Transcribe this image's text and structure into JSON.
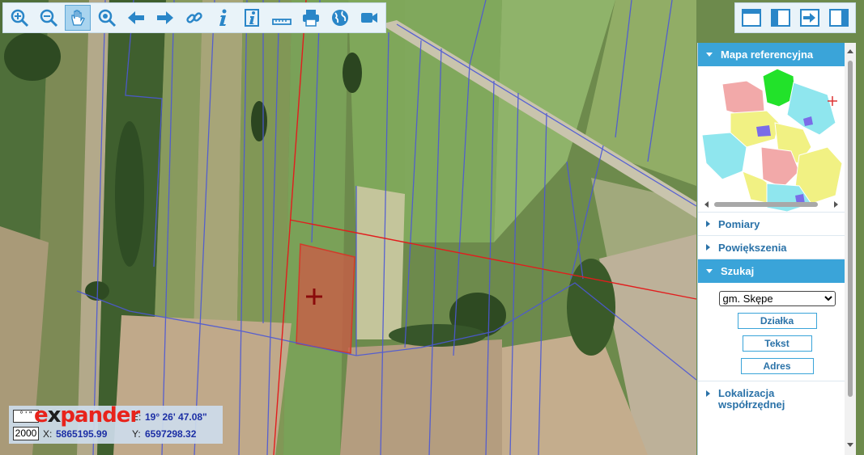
{
  "toolbar": {
    "items": [
      {
        "name": "zoom-in-button",
        "icon": "zoom-in-icon"
      },
      {
        "name": "zoom-out-button",
        "icon": "zoom-out-icon"
      },
      {
        "name": "pan-button",
        "icon": "hand-icon",
        "active": true
      },
      {
        "name": "zoom-extent-button",
        "icon": "magnifier-icon"
      },
      {
        "name": "back-button",
        "icon": "arrow-left-icon"
      },
      {
        "name": "forward-button",
        "icon": "arrow-right-icon"
      },
      {
        "name": "link-button",
        "icon": "link-icon"
      },
      {
        "name": "info-button",
        "icon": "info-icon"
      },
      {
        "name": "info-detail-button",
        "icon": "info-document-icon"
      },
      {
        "name": "measure-button",
        "icon": "ruler-icon"
      },
      {
        "name": "print-button",
        "icon": "printer-icon"
      },
      {
        "name": "globe-button",
        "icon": "globe-icon"
      },
      {
        "name": "video-button",
        "icon": "camera-icon"
      }
    ],
    "colors": {
      "accent": "#2a86c8",
      "active_bg": "#a9d4ef"
    }
  },
  "window_controls": [
    {
      "name": "layout-full-button",
      "icon": "window-icon"
    },
    {
      "name": "layout-left-panel-button",
      "icon": "left-panel-icon"
    },
    {
      "name": "layout-export-button",
      "icon": "export-arrow-icon"
    },
    {
      "name": "layout-right-panel-button",
      "icon": "right-panel-icon"
    }
  ],
  "panel": {
    "reference_map": {
      "title": "Mapa referencyjna"
    },
    "measurements": {
      "title": "Pomiary"
    },
    "zooms": {
      "title": "Powiększenia"
    },
    "search": {
      "title": "Szukaj",
      "selected_option": "gm. Skępe",
      "buttons": {
        "parcel": "Działka",
        "text": "Tekst",
        "address": "Adres"
      }
    },
    "location": {
      "title_line1": "Lokalizacja",
      "title_line2": "współrzędnej"
    }
  },
  "coordinates": {
    "format_label": "° ' \"",
    "scale": "2000",
    "lon_label": "E:",
    "lon_value": "19° 26' 47.08\"",
    "x_label": "X:",
    "x_value": "5865195.99",
    "y_label": "Y:",
    "y_value": "6597298.32"
  },
  "logo": {
    "part1": "e",
    "part2": "x",
    "part3": "pander",
    "color_red": "#e8231b",
    "color_dark": "#1d1d1d"
  }
}
